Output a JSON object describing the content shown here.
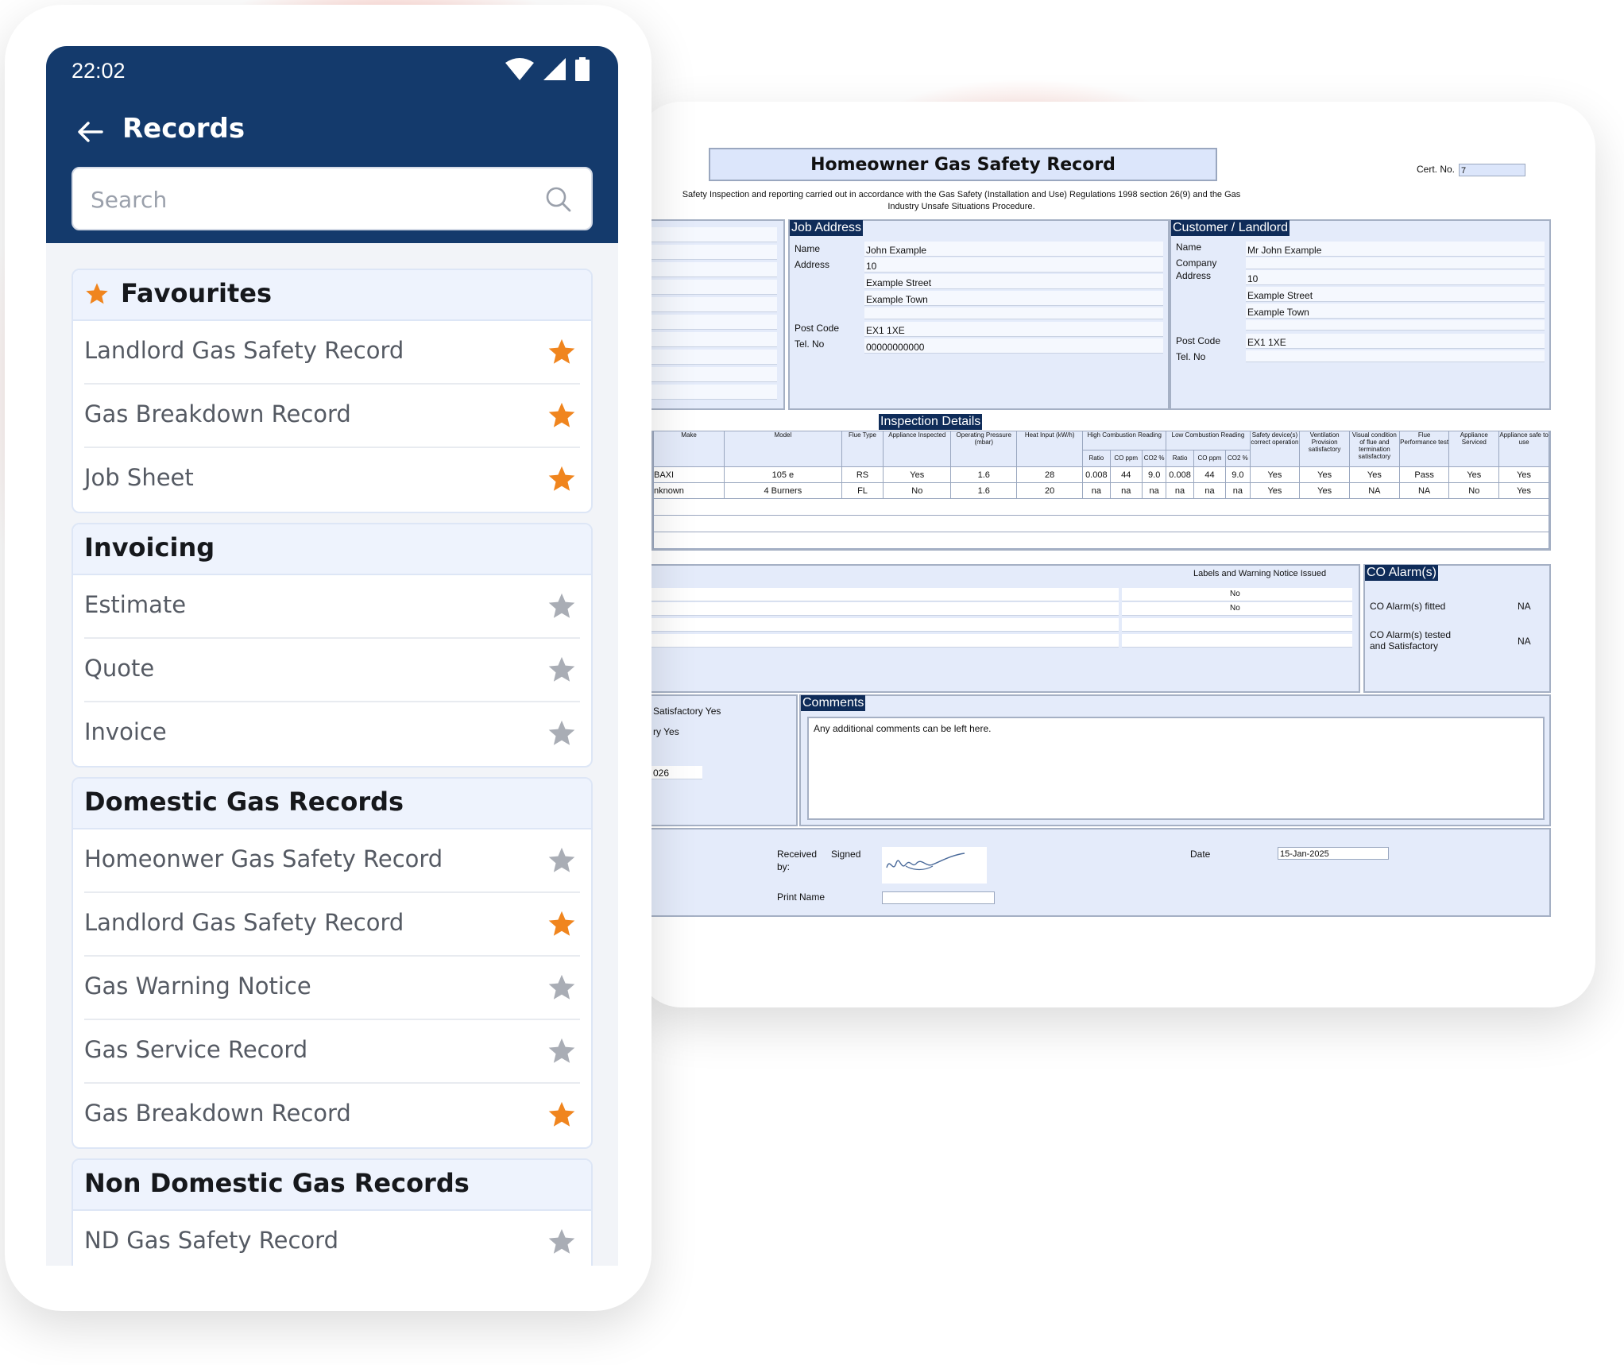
{
  "colors": {
    "app_bar": "#143a6c",
    "star_active": "#f0851e",
    "star_inactive": "#a9adb5",
    "doc_header": "#0f2c59",
    "doc_field": "#e4ebfa"
  },
  "status_bar": {
    "time": "22:02",
    "icons": [
      "wifi-icon",
      "signal-icon",
      "battery-icon"
    ]
  },
  "app_bar": {
    "title": "Records",
    "back_icon": "arrow-left-icon"
  },
  "search": {
    "placeholder": "Search",
    "value": ""
  },
  "sections": [
    {
      "title": "Favourites",
      "header_icon": "star-icon",
      "items": [
        {
          "label": "Landlord Gas Safety Record",
          "favourite": true
        },
        {
          "label": "Gas Breakdown Record",
          "favourite": true
        },
        {
          "label": "Job Sheet",
          "favourite": true
        }
      ]
    },
    {
      "title": "Invoicing",
      "items": [
        {
          "label": "Estimate",
          "favourite": false
        },
        {
          "label": "Quote",
          "favourite": false
        },
        {
          "label": "Invoice",
          "favourite": false
        }
      ]
    },
    {
      "title": "Domestic Gas Records",
      "items": [
        {
          "label": "Homeonwer Gas Safety Record",
          "favourite": false
        },
        {
          "label": "Landlord Gas Safety Record",
          "favourite": true
        },
        {
          "label": "Gas Warning Notice",
          "favourite": false
        },
        {
          "label": "Gas Service Record",
          "favourite": false
        },
        {
          "label": "Gas Breakdown Record",
          "favourite": true
        }
      ]
    },
    {
      "title": "Non Domestic Gas Records",
      "items": [
        {
          "label": "ND Gas Safety Record",
          "favourite": false
        }
      ]
    }
  ],
  "document": {
    "title": "Homeowner Gas Safety Record",
    "cert_label": "Cert. No.",
    "cert_value": "7",
    "subtitle_line1": "Safety Inspection and reporting carried out in accordance with the Gas Safety (Installation and Use) Regulations 1998 section 26(9) and the Gas",
    "subtitle_line2": "Industry Unsafe Situations Procedure.",
    "job_address": {
      "header": "Job Address",
      "name_label": "Name",
      "name": "John Example",
      "address_label": "Address",
      "address_lines": [
        "10",
        "Example Street",
        "Example Town"
      ],
      "postcode_label": "Post Code",
      "postcode": "EX1 1XE",
      "tel_label": "Tel. No",
      "tel": "00000000000"
    },
    "customer": {
      "header": "Customer / Landlord",
      "name_label": "Name",
      "name": "Mr John Example",
      "company_label": "Company",
      "address_label": "Address",
      "address_lines": [
        "10",
        "Example Street",
        "Example Town"
      ],
      "postcode_label": "Post Code",
      "postcode": "EX1 1XE",
      "tel_label": "Tel. No"
    },
    "inspection": {
      "header": "Inspection Details",
      "columns": [
        "Make",
        "Model",
        "Flue Type",
        "Appliance Inspected",
        "Operating Pressure (mbar)",
        "Heat Input (kW/h)",
        "High Combustion Reading",
        "Low Combustion Reading",
        "Safety device(s) correct operation",
        "Ventilation Provision satisfactory",
        "Visual condition of flue and termination satisfactory",
        "Flue Performance test",
        "Appliance Serviced",
        "Appliance safe to use"
      ],
      "sub_columns": [
        "Ratio",
        "CO ppm",
        "CO2 %"
      ],
      "rows": [
        [
          "BAXI",
          "105 e",
          "RS",
          "Yes",
          "1.6",
          "28",
          "0.008",
          "44",
          "9.0",
          "0.008",
          "44",
          "9.0",
          "Yes",
          "Yes",
          "Yes",
          "Pass",
          "Yes",
          "Yes"
        ],
        [
          "nknown",
          "4 Burners",
          "FL",
          "No",
          "1.6",
          "20",
          "na",
          "na",
          "na",
          "na",
          "na",
          "na",
          "Yes",
          "Yes",
          "NA",
          "NA",
          "No",
          "Yes"
        ]
      ]
    },
    "labels_issued": {
      "title": "Labels and Warning Notice Issued",
      "values": [
        "No",
        "No"
      ]
    },
    "co_alarms": {
      "header": "CO Alarm(s)",
      "fitted_label": "CO Alarm(s) fitted",
      "fitted": "NA",
      "tested_label1": "CO Alarm(s) tested",
      "tested_label2": "and Satisfactory",
      "tested": "NA"
    },
    "summary": {
      "line1": "Satisfactory Yes",
      "line2": "ry  Yes",
      "line3": "026"
    },
    "comments": {
      "header": "Comments",
      "text": "Any additional comments can be left here."
    },
    "signoff": {
      "received_label1": "Received",
      "received_label2": "by:",
      "signed_label": "Signed",
      "print_name_label": "Print Name",
      "date_label": "Date",
      "date": "15-Jan-2025"
    }
  }
}
